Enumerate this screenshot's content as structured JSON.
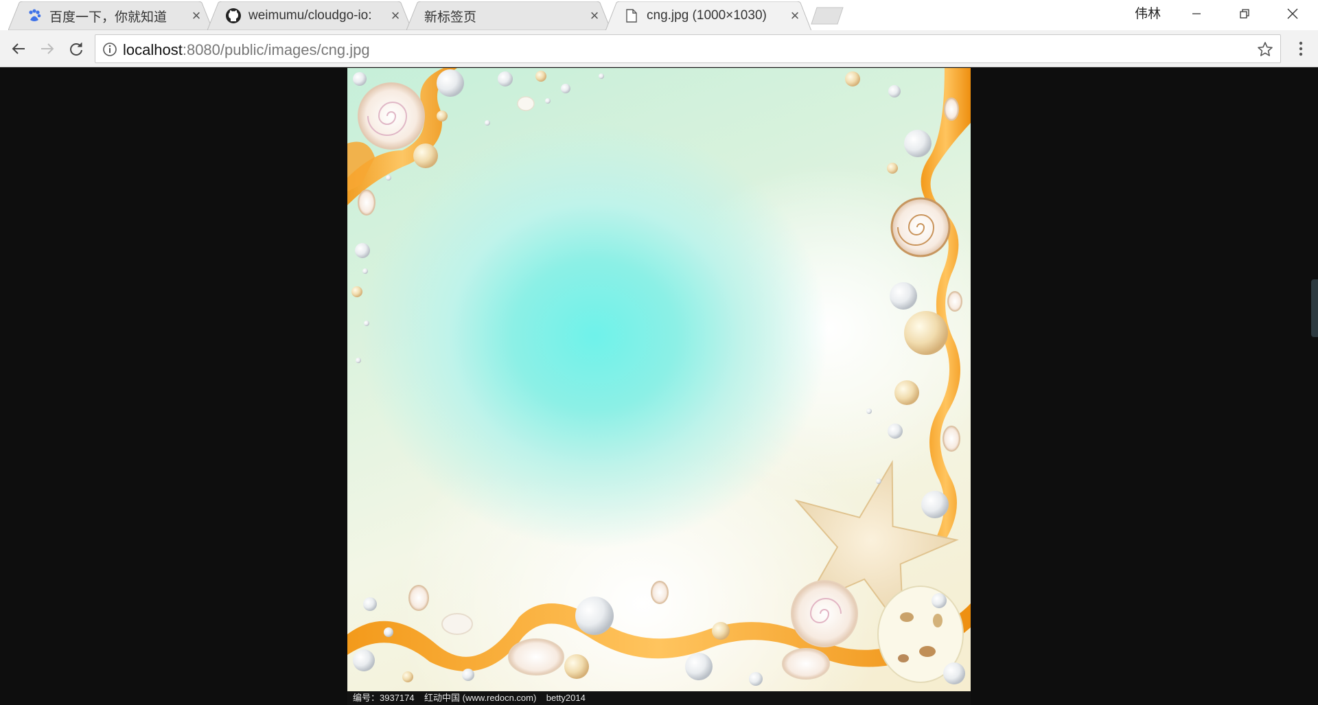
{
  "browser": {
    "tabs": [
      {
        "label": "百度一下，你就知道",
        "icon": "baidu-paw-icon",
        "active": false
      },
      {
        "label": "weimumu/cloudgo-io:",
        "icon": "github-icon",
        "active": false
      },
      {
        "label": "新标签页",
        "icon": "",
        "active": false
      },
      {
        "label": "cng.jpg (1000×1030)",
        "icon": "file-icon",
        "active": true
      }
    ],
    "profile_name": "伟林",
    "address": {
      "host": "localhost",
      "path": ":8080/public/images/cng.jpg"
    }
  },
  "image": {
    "caption": "编号：3937174    红动中国 (www.redocn.com)    betty2014"
  },
  "colors": {
    "ribbon": "#f39a1b",
    "background": "#0e0e0e",
    "toolbar": "#f2f2f2"
  }
}
